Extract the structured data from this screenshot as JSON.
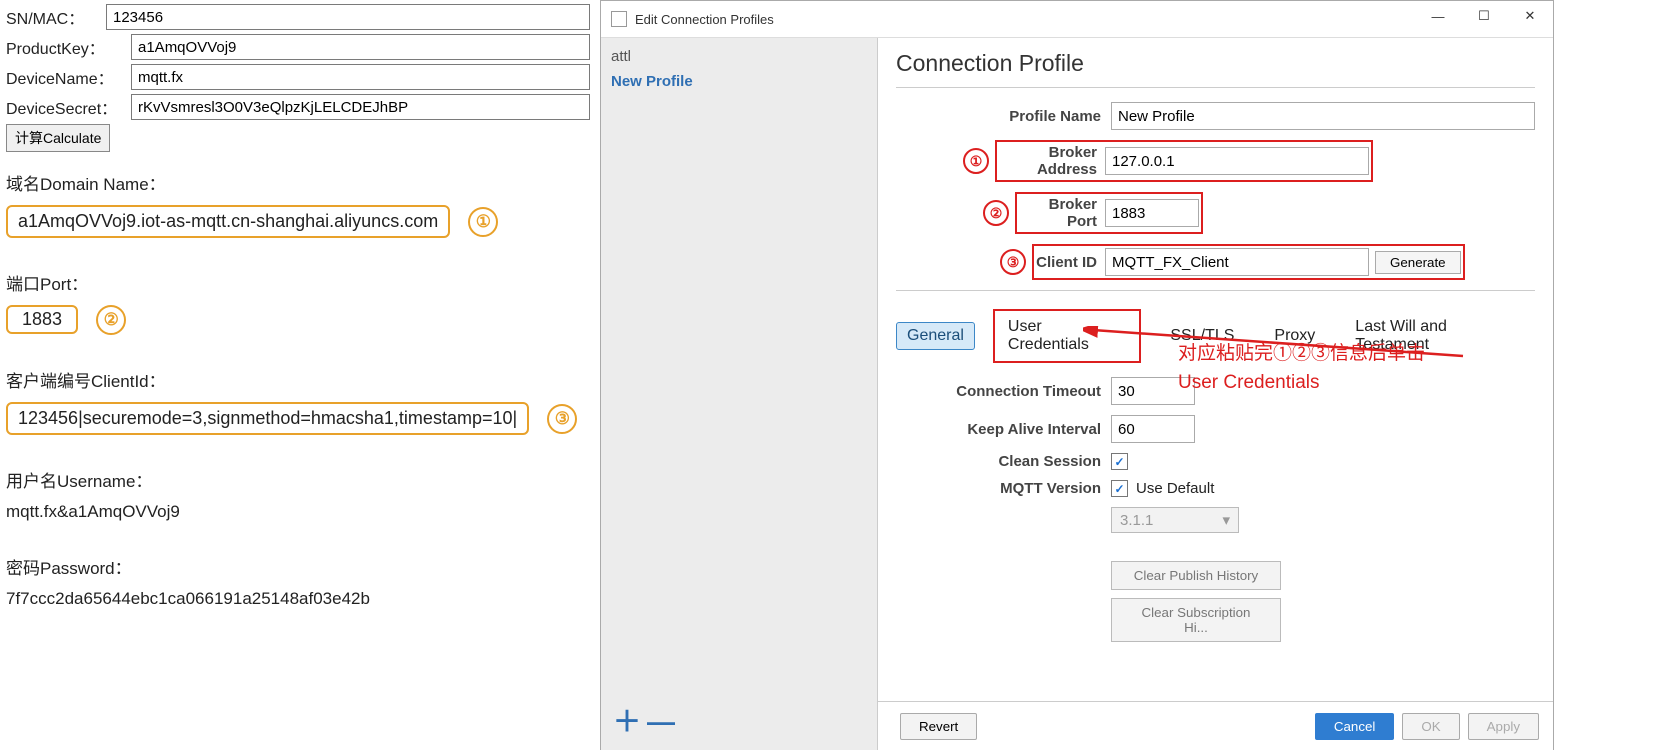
{
  "left": {
    "sn_label": "SN/MAC：",
    "sn_value": "123456",
    "pk_label": "ProductKey：",
    "pk_value": "a1AmqOVVoj9",
    "dn_label": "DeviceName：",
    "dn_value": "mqtt.fx",
    "ds_label": "DeviceSecret：",
    "ds_value": "rKvVsmresl3O0V3eQlpzKjLELCDEJhBP",
    "calc_btn": "计算Calculate",
    "domain_label": "域名Domain Name：",
    "domain_value": "a1AmqOVVoj9.iot-as-mqtt.cn-shanghai.aliyuncs.com",
    "port_label": "端口Port：",
    "port_value": "1883",
    "clientid_label": "客户端编号ClientId：",
    "clientid_value": "123456|securemode=3,signmethod=hmacsha1,timestamp=10|",
    "user_label": "用户名Username：",
    "user_value": "mqtt.fx&a1AmqOVVoj9",
    "pwd_label": "密码Password：",
    "pwd_value": "7f7ccc2da65644ebc1ca066191a25148af03e42b",
    "mark1": "①",
    "mark2": "②",
    "mark3": "③"
  },
  "dlg": {
    "title": "Edit Connection Profiles",
    "side_item1": "attl",
    "side_item2": "New Profile",
    "heading": "Connection Profile",
    "profile_name_lbl": "Profile Name",
    "profile_name_val": "New Profile",
    "broker_addr_lbl": "Broker Address",
    "broker_addr_val": "127.0.0.1",
    "broker_port_lbl": "Broker Port",
    "broker_port_val": "1883",
    "client_id_lbl": "Client ID",
    "client_id_val": "MQTT_FX_Client",
    "generate_btn": "Generate",
    "tabs": {
      "general": "General",
      "usercred": "User Credentials",
      "ssl": "SSL/TLS",
      "proxy": "Proxy",
      "lwt": "Last Will and Testament"
    },
    "conn_timeout_lbl": "Connection Timeout",
    "conn_timeout_val": "30",
    "keepalive_lbl": "Keep Alive Interval",
    "keepalive_val": "60",
    "clean_lbl": "Clean Session",
    "mqttver_lbl": "MQTT Version",
    "mqttver_use": "Use Default",
    "mqttver_val": "3.1.1",
    "clear_pub": "Clear Publish History",
    "clear_sub": "Clear Subscription Hi...",
    "revert": "Revert",
    "cancel": "Cancel",
    "ok": "OK",
    "apply": "Apply",
    "mark1": "①",
    "mark2": "②",
    "mark3": "③",
    "anno1": "对应粘贴完①②③信息后单击",
    "anno2": "User Credentials",
    "plus": "＋",
    "minus": "—",
    "check": "✓",
    "caret": "▾"
  },
  "win": {
    "min": "—",
    "max": "☐",
    "close": "✕"
  }
}
